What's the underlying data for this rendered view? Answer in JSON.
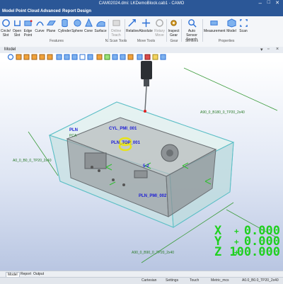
{
  "window": {
    "title": "CAM02024.dmi: LKDemoBlock.cab1 - CAMO"
  },
  "menu": {
    "tabs": [
      "Model",
      "Point Cloud",
      "Advanced",
      "Report Design"
    ]
  },
  "ribbon": {
    "buttons": {
      "circle": "Circle/ Slot",
      "open_slot": "Open Slot",
      "edge_point": "Edge Point",
      "curve": "Curve",
      "plane": "Plane",
      "cylinder": "Cylinder",
      "sphere": "Sphere",
      "cone": "Cone",
      "surface": "Surface",
      "online_teach": "Online Teach",
      "relative": "Relative",
      "absolute": "Absolute",
      "rotary_move": "Rotary Move",
      "inspect_gear": "Inspect Gear",
      "auto_sensor": "Auto Sensor Search",
      "measurement": "Measurement",
      "model": "Model",
      "scan": "Scan"
    },
    "groups": {
      "features": "Features",
      "scan_tools": "N. Scan Tools",
      "move_tools": "Move Tools",
      "gear": "Gear",
      "sensors": "Sensors",
      "properties": "Properties"
    }
  },
  "model_pane": {
    "title": "Model"
  },
  "viewport": {
    "labels": {
      "cyl": "CYL_PMI_001",
      "pln_top": "PLN_TOP_001",
      "pln_left": "PLN",
      "pln_pmi": "PLN_PMI_002",
      "pln_small": "PCA",
      "mid": "5-2",
      "dim_top": "A90_0_B180_0_TP20_2x40",
      "dim_left": "A0_0_B0_0_TP20_2x40",
      "dim_bottom": "A90_0_B90_0_TP20_2x40"
    }
  },
  "readout": {
    "x_label": "X",
    "x_value": "0.000",
    "y_label": "Y",
    "y_value": "0.000",
    "z_label": "Z",
    "z_value": "100.000",
    "sign": "+"
  },
  "bottom_tabs": [
    "Model",
    "Report",
    "Output"
  ],
  "status": {
    "cartesian": "Cartesian",
    "settings": "Settings",
    "touch": "Touch",
    "metric": "Metric_mcs",
    "probe": "A0.0_B0.0_TP20_2x40"
  },
  "colors": {
    "title_bar": "#2b5797",
    "readout": "#1fd01f",
    "feature_label": "#1b1bd6"
  }
}
